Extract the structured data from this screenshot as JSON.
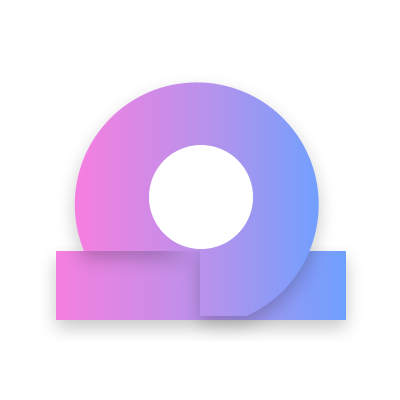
{
  "logo": {
    "icon": "looped-ribbon-logo-icon",
    "gradient": {
      "start": "#F57FE0",
      "mid": "#B493EC",
      "end": "#6FA0FF"
    },
    "background": "#FFFFFF"
  }
}
